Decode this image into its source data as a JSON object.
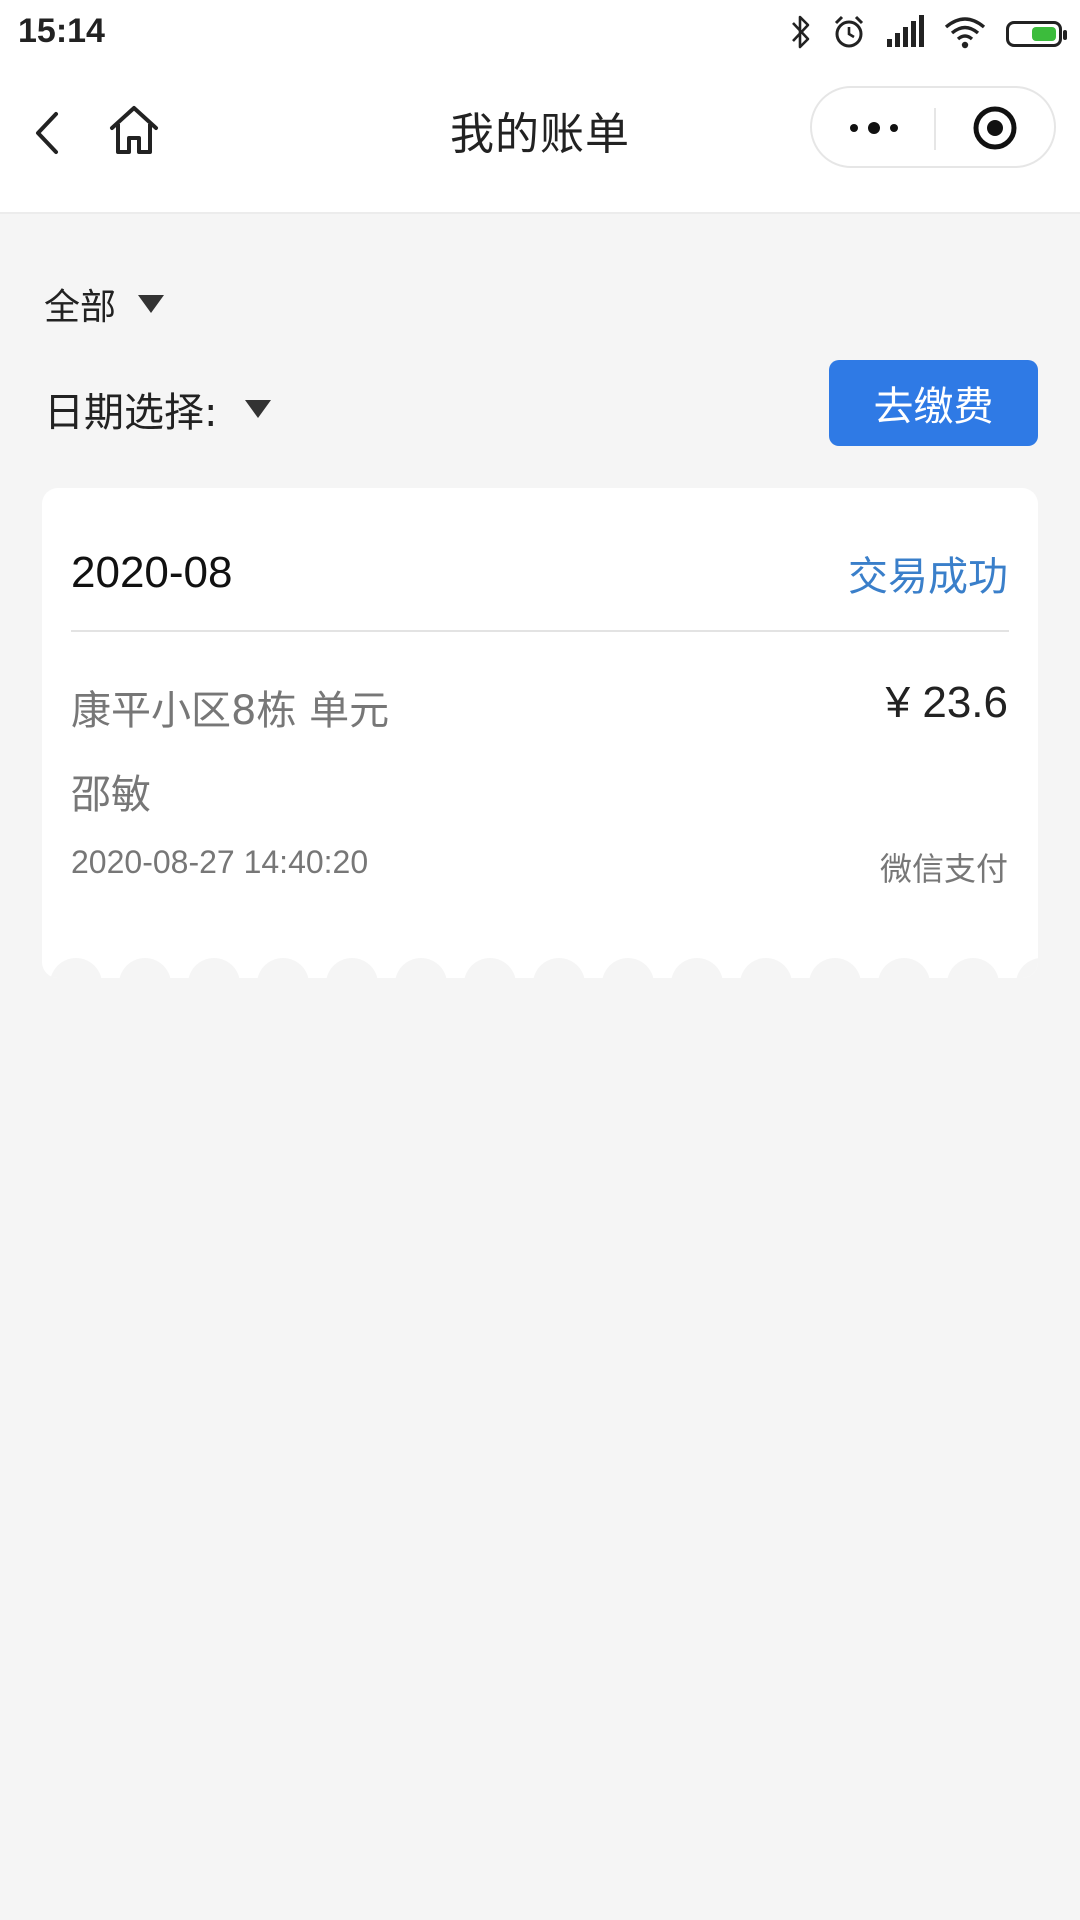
{
  "status_bar": {
    "time": "15:14",
    "icons": [
      "bluetooth-icon",
      "alarm-icon",
      "signal-icon",
      "wifi-icon",
      "battery-charging-icon"
    ]
  },
  "nav": {
    "title": "我的账单",
    "icons": [
      "back-icon",
      "home-icon",
      "more-icon",
      "target-icon"
    ]
  },
  "filters": {
    "category_label": "全部",
    "date_label": "日期选择:"
  },
  "actions": {
    "pay_label": "去缴费"
  },
  "bill": {
    "month": "2020-08",
    "status": "交易成功",
    "address": "康平小区8栋 单元",
    "amount": "¥ 23.6",
    "name": "邵敏",
    "datetime": "2020-08-27 14:40:20",
    "payment_method": "微信支付"
  },
  "colors": {
    "accent": "#2f7ae5",
    "status_text": "#3a7fca",
    "background": "#f5f5f5",
    "card": "#ffffff",
    "battery": "#3cbc3c"
  }
}
